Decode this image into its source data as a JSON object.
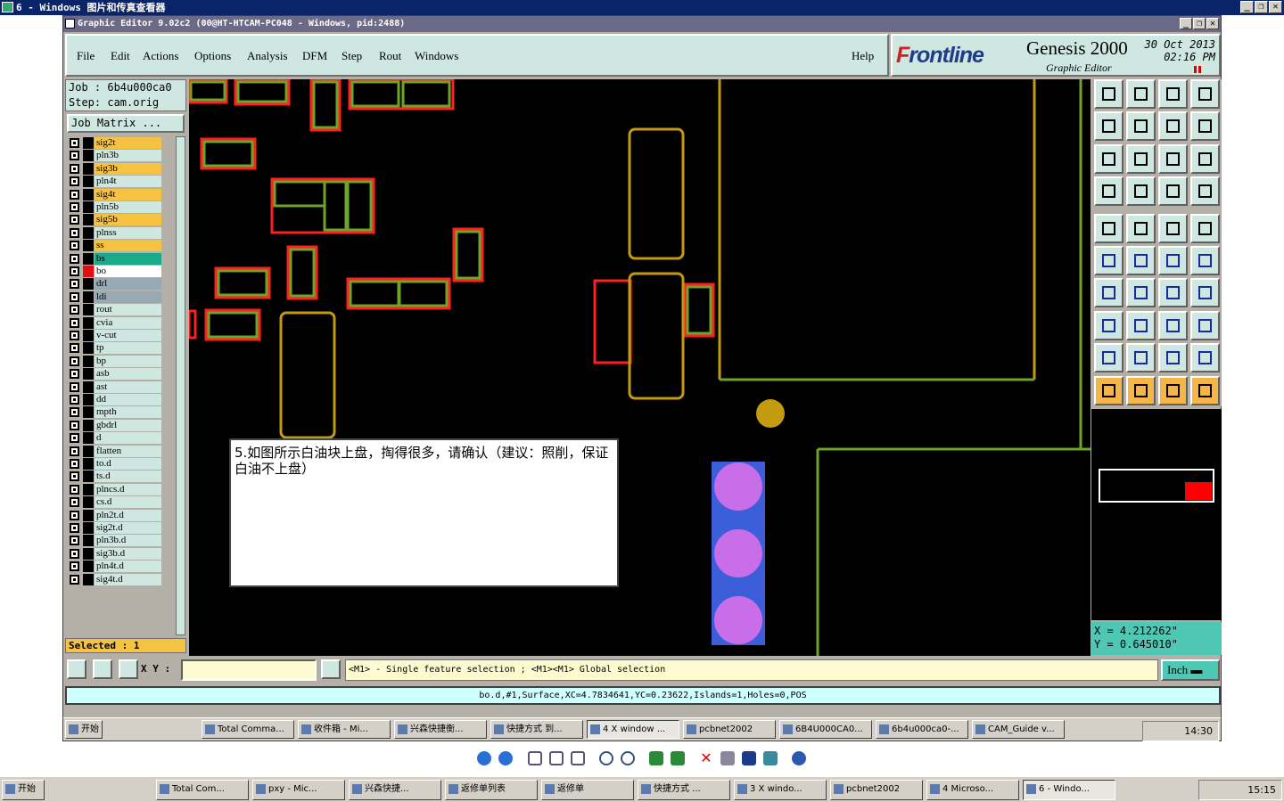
{
  "viewer": {
    "title": "6 - Windows 图片和传真查看器"
  },
  "app": {
    "title": "Graphic Editor 9.02c2  (00@HT-HTCAM-PC048 - Windows, pid:2488)",
    "menu": {
      "file": "File",
      "edit": "Edit",
      "actions": "Actions",
      "options": "Options",
      "analysis": "Analysis",
      "dfm": "DFM",
      "step": "Step",
      "rout": "Rout",
      "windows": "Windows",
      "help": "Help"
    },
    "brand": {
      "logo_prefix": "F",
      "logo_rest": "rontline",
      "product": "Genesis 2000",
      "subtitle": "Graphic Editor",
      "date": "30 Oct 2013",
      "time": "02:16 PM"
    }
  },
  "job": {
    "job_label": "Job  :  6b4u000ca0",
    "step_label": "Step: cam.orig",
    "matrix_button": "Job Matrix ..."
  },
  "layers": [
    {
      "name": "sig2t",
      "color": "#f5c242"
    },
    {
      "name": "pln3b",
      "color": "#cfe7e1"
    },
    {
      "name": "sig3b",
      "color": "#f5c242"
    },
    {
      "name": "pln4t",
      "color": "#cfe7e1"
    },
    {
      "name": "sig4t",
      "color": "#f5c242"
    },
    {
      "name": "pln5b",
      "color": "#cfe7e1"
    },
    {
      "name": "sig5b",
      "color": "#f5c242"
    },
    {
      "name": "plnss",
      "color": "#cfe7e1"
    },
    {
      "name": "ss",
      "color": "#f5c242"
    },
    {
      "name": "bs",
      "color": "#1aa98a"
    },
    {
      "name": "bo",
      "color": "#ffffff",
      "swatch": "#e01010"
    },
    {
      "name": "drl",
      "color": "#97a9b4"
    },
    {
      "name": "ldi",
      "color": "#97a9b4"
    },
    {
      "name": "rout",
      "color": "#cfe7e1"
    },
    {
      "name": "cvia",
      "color": "#cfe7e1"
    },
    {
      "name": "v-cut",
      "color": "#cfe7e1"
    },
    {
      "name": "tp",
      "color": "#cfe7e1"
    },
    {
      "name": "bp",
      "color": "#cfe7e1"
    },
    {
      "name": "asb",
      "color": "#cfe7e1"
    },
    {
      "name": "ast",
      "color": "#cfe7e1"
    },
    {
      "name": "dd",
      "color": "#cfe7e1"
    },
    {
      "name": "mpth",
      "color": "#cfe7e1"
    },
    {
      "name": "gbdrl",
      "color": "#cfe7e1"
    },
    {
      "name": "d",
      "color": "#cfe7e1"
    },
    {
      "name": "flatten",
      "color": "#cfe7e1"
    },
    {
      "name": "to.d",
      "color": "#cfe7e1"
    },
    {
      "name": "ts.d",
      "color": "#cfe7e1"
    },
    {
      "name": "plncs.d",
      "color": "#cfe7e1"
    },
    {
      "name": "cs.d",
      "color": "#cfe7e1"
    },
    {
      "name": "pln2t.d",
      "color": "#cfe7e1"
    },
    {
      "name": "sig2t.d",
      "color": "#cfe7e1"
    },
    {
      "name": "pln3b.d",
      "color": "#cfe7e1"
    },
    {
      "name": "sig3b.d",
      "color": "#cfe7e1"
    },
    {
      "name": "pln4t.d",
      "color": "#cfe7e1"
    },
    {
      "name": "sig4t.d",
      "color": "#cfe7e1"
    }
  ],
  "selected": "Selected : 1",
  "annotation": {
    "text": "5.如图所示白油块上盘，掏得很多，请确认（建议：照削，保证白油不上盘）"
  },
  "coords": {
    "x": "X  =  4.212262\"",
    "y": "Y  =  0.645010\""
  },
  "xy": {
    "label": "X Y :",
    "value": ""
  },
  "hint": "<M1> - Single feature selection ; <M1><M1> Global selection",
  "units": "Inch",
  "status": "bo.d,#1,Surface,XC=4.7834641,YC=0.23622,Islands=1,Holes=0,POS",
  "inner_taskbar": {
    "start": "开始",
    "items": [
      "Total Comma...",
      "收件箱 - Mi...",
      "兴森快捷衡...",
      "快捷方式 到...",
      "4 X window ...",
      "pcbnet2002",
      "6B4U000CA0...",
      "6b4u000ca0-...",
      "CAM_Guide v..."
    ],
    "clock": "14:30"
  },
  "taskbar": {
    "start": "开始",
    "items": [
      "Total Com...",
      "pxy - Mic...",
      "兴森快捷...",
      "返修单列表",
      "返修单",
      "快捷方式 ...",
      "3 X windo...",
      "pcbnet2002",
      "4 Microso...",
      "6 - Windo..."
    ],
    "clock": "15:15"
  }
}
